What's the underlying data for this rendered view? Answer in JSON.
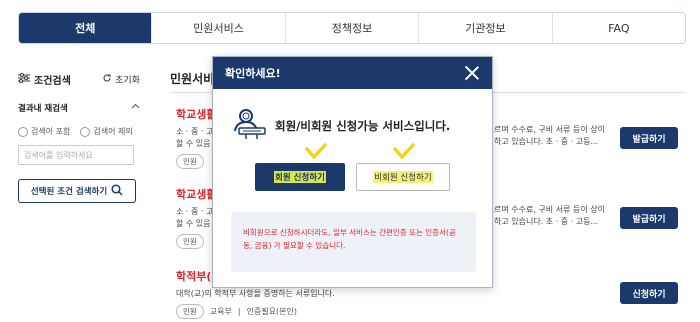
{
  "tabs": [
    "전체",
    "민원서비스",
    "정책정보",
    "기관정보",
    "FAQ"
  ],
  "sidebar": {
    "title": "조건검색",
    "reset": "초기화",
    "refine_title": "결과내 재검색",
    "radio_include": "검색어 포함",
    "radio_exclude": "검색어 제외",
    "input_placeholder": "검색어를 입력하세요",
    "search_button": "선택된 조건 검색하기"
  },
  "main": {
    "section_title": "민원서비스",
    "items": [
      {
        "title": "학교생활",
        "desc": "소 · 중 · 고등",
        "desc_more": "할 수 있음",
        "right_desc": "르며 수수료, 구비 서류 등이 상이",
        "right_desc2": "하고 있습니다. 초 · 중 · 고등...",
        "tag": "민원",
        "button": "발급하기"
      },
      {
        "title": "학교생활",
        "desc": "소 · 중 · 고등",
        "desc_more": "할 수 있음",
        "right_desc": "르며 수수료, 구비 서류 등이 상이",
        "right_desc2": "하고 있습니다. 초 · 중 · 고등...",
        "tag": "민원",
        "button": "발급하기"
      },
      {
        "title": "학적부(",
        "desc": "대학(교)의 학적부 사항을 증명하는 서류입니다.",
        "tag": "민원",
        "agency": "교육부",
        "auth": "인증필요(본인)",
        "button": "신청하기"
      }
    ]
  },
  "modal": {
    "title": "확인하세요!",
    "message": "회원/비회원 신청가능 서비스입니다.",
    "member_button": "회원 신청하기",
    "nonmember_button": "비회원 신청하기",
    "notice": "비회원으로 신청하시더라도, 일부 서비스는 간편인증 또는 인증서(공동, 금융) 가 필요할 수 있습니다."
  },
  "colors": {
    "navy": "#1b3a6b",
    "red": "#e0262b",
    "highlight": "#d8e64a",
    "check": "#f2d21b"
  }
}
